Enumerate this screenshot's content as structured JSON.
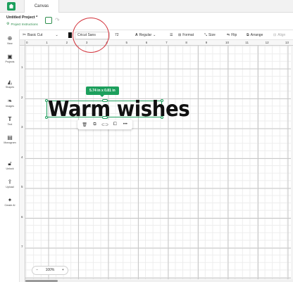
{
  "header": {
    "tab_label": "Canvas"
  },
  "project": {
    "title": "Untitled Project *",
    "instructions": "Project Instructions"
  },
  "toolbar": {
    "operation": "Basic Cut",
    "font": "Cricut Sans",
    "font_size": "72",
    "style": "Regular",
    "format_label": "Format",
    "size_label": "Size",
    "flip_label": "Flip",
    "arrange_label": "Arrange",
    "align_label": "Align"
  },
  "sidebar": {
    "items": [
      {
        "label": "New",
        "icon": "plus-icon"
      },
      {
        "label": "Projects",
        "icon": "projects-icon"
      },
      {
        "label": "Shapes",
        "icon": "shapes-icon"
      },
      {
        "label": "Images",
        "icon": "images-icon"
      },
      {
        "label": "Text",
        "icon": "text-icon"
      },
      {
        "label": "Monogram",
        "icon": "monogram-icon"
      },
      {
        "label": "Unlock",
        "icon": "lock-icon"
      },
      {
        "label": "Upload",
        "icon": "upload-icon"
      },
      {
        "label": "Create AI",
        "icon": "sparkle-icon"
      }
    ]
  },
  "rulers": {
    "top": [
      "0",
      "1",
      "2",
      "3",
      "4",
      "5",
      "6",
      "7",
      "8",
      "9",
      "10",
      "11",
      "12",
      "13"
    ],
    "left": [
      "1",
      "2",
      "3",
      "4",
      "5",
      "6",
      "7"
    ]
  },
  "canvas": {
    "text": "Warm wishes",
    "dimensions": "5.74 in x 0.81 in"
  },
  "zoom": {
    "level": "100%",
    "minus": "−",
    "plus": "+"
  },
  "colors": {
    "accent": "#1c9f5c",
    "text_color": "#111111",
    "annotation": "#d2313a"
  }
}
